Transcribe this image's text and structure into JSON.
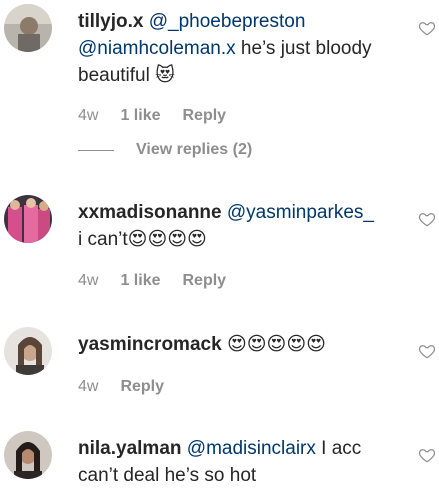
{
  "comments": [
    {
      "username": "tillyjo.x",
      "mention1": "@_phoebepreston",
      "mention2": "@niamhcoleman.x",
      "text": " he’s just bloody beautiful ",
      "emoji": "😻",
      "time": "4w",
      "likes": "1 like",
      "reply": "Reply",
      "view_replies": "View replies (2)"
    },
    {
      "username": "xxmadisonanne",
      "mention1": "@yasminparkes_",
      "text": "i can’t",
      "emoji": "😍😍😍😍",
      "time": "4w",
      "likes": "1 like",
      "reply": "Reply"
    },
    {
      "username": "yasmincromack",
      "emoji": "😍😍😍😍😍",
      "time": "4w",
      "reply": "Reply"
    },
    {
      "username": "nila.yalman",
      "mention1": "@madisinclairx",
      "text": " I acc can’t deal he’s so hot"
    }
  ],
  "icons": {
    "like": "heart-outline-icon"
  }
}
